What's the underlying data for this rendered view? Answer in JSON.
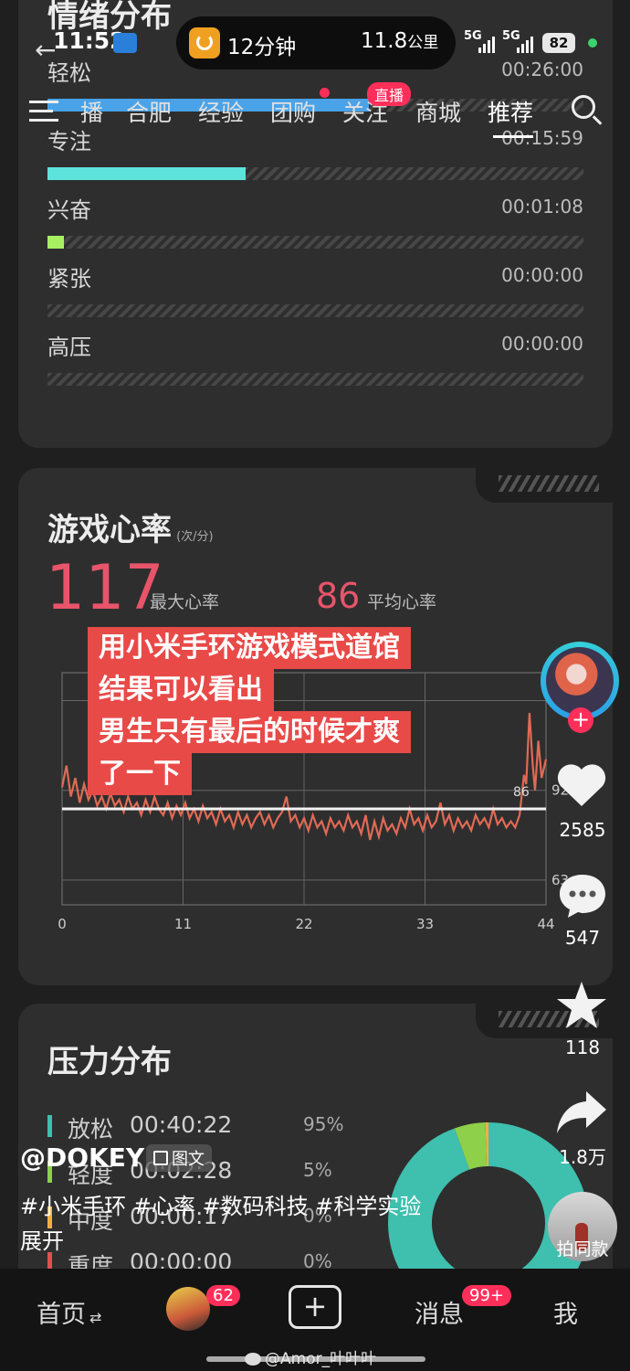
{
  "status_bar": {
    "time": "11:52",
    "ride_time": "12分钟",
    "ride_distance": "11.8",
    "ride_unit": "公里",
    "battery": "82",
    "net1": "5G",
    "net2": "5G"
  },
  "top_tabs": {
    "items": [
      "播",
      "合肥",
      "经验",
      "团购",
      "关注",
      "商城",
      "推荐"
    ],
    "live_badge": "直播"
  },
  "emotion": {
    "title": "情绪分布",
    "rows": [
      {
        "label": "轻松",
        "time": "00:26:00",
        "fill": 0.6,
        "color": "#4aa3e8"
      },
      {
        "label": "专注",
        "time": "00:15:59",
        "fill": 0.37,
        "color": "#5de3dc"
      },
      {
        "label": "兴奋",
        "time": "00:01:08",
        "fill": 0.03,
        "color": "#a8f062"
      },
      {
        "label": "紧张",
        "time": "00:00:00",
        "fill": 0,
        "color": "#f0b040"
      },
      {
        "label": "高压",
        "time": "00:00:00",
        "fill": 0,
        "color": "#e05050"
      }
    ]
  },
  "heart": {
    "title": "游戏心率",
    "unit": "(次/分)",
    "max_value": "117",
    "max_label": "最大心率",
    "avg_value": "86",
    "avg_label": "平均心率"
  },
  "chart_data": {
    "type": "line",
    "x_ticks": [
      "0",
      "11",
      "22",
      "33",
      "44"
    ],
    "y_ticks": [
      "121",
      "92",
      "63"
    ],
    "avg_marker": "86",
    "xlim": [
      0,
      44
    ],
    "ylim": [
      55,
      130
    ],
    "avg": 86,
    "series": [
      {
        "values": [
          [
            0,
            93
          ],
          [
            0.4,
            100
          ],
          [
            0.8,
            90
          ],
          [
            1.2,
            96
          ],
          [
            1.6,
            88
          ],
          [
            2,
            94
          ],
          [
            2.4,
            89
          ],
          [
            2.8,
            92
          ],
          [
            3.2,
            87
          ],
          [
            3.6,
            90
          ],
          [
            4,
            86
          ],
          [
            4.4,
            91
          ],
          [
            4.8,
            87
          ],
          [
            5.2,
            89
          ],
          [
            5.6,
            85
          ],
          [
            6,
            90
          ],
          [
            6.4,
            86
          ],
          [
            6.8,
            88
          ],
          [
            7.2,
            84
          ],
          [
            7.6,
            89
          ],
          [
            8,
            85
          ],
          [
            8.4,
            90
          ],
          [
            8.8,
            86
          ],
          [
            9.2,
            84
          ],
          [
            9.6,
            88
          ],
          [
            10,
            83
          ],
          [
            10.4,
            87
          ],
          [
            10.8,
            84
          ],
          [
            11.2,
            88
          ],
          [
            11.6,
            83
          ],
          [
            12,
            86
          ],
          [
            12.4,
            82
          ],
          [
            12.8,
            87
          ],
          [
            13.2,
            83
          ],
          [
            13.6,
            85
          ],
          [
            14,
            81
          ],
          [
            14.4,
            86
          ],
          [
            14.8,
            82
          ],
          [
            15.2,
            84
          ],
          [
            15.6,
            80
          ],
          [
            16,
            85
          ],
          [
            16.4,
            81
          ],
          [
            16.8,
            84
          ],
          [
            17.2,
            80
          ],
          [
            17.6,
            83
          ],
          [
            18,
            85
          ],
          [
            18.4,
            81
          ],
          [
            18.8,
            84
          ],
          [
            19.2,
            80
          ],
          [
            19.6,
            83
          ],
          [
            20,
            85
          ],
          [
            20.4,
            90
          ],
          [
            20.8,
            82
          ],
          [
            21.2,
            84
          ],
          [
            21.6,
            80
          ],
          [
            22,
            83
          ],
          [
            22.4,
            79
          ],
          [
            22.8,
            84
          ],
          [
            23.2,
            80
          ],
          [
            23.6,
            82
          ],
          [
            24,
            78
          ],
          [
            24.4,
            83
          ],
          [
            24.8,
            80
          ],
          [
            25.2,
            82
          ],
          [
            25.6,
            79
          ],
          [
            26,
            84
          ],
          [
            26.4,
            80
          ],
          [
            26.8,
            82
          ],
          [
            27.2,
            78
          ],
          [
            27.6,
            84
          ],
          [
            28,
            76
          ],
          [
            28.4,
            82
          ],
          [
            28.8,
            77
          ],
          [
            29.2,
            83
          ],
          [
            29.6,
            79
          ],
          [
            30,
            81
          ],
          [
            30.4,
            78
          ],
          [
            30.8,
            83
          ],
          [
            31.2,
            80
          ],
          [
            31.6,
            86
          ],
          [
            32,
            81
          ],
          [
            32.4,
            83
          ],
          [
            32.8,
            79
          ],
          [
            33.2,
            84
          ],
          [
            33.6,
            80
          ],
          [
            34,
            82
          ],
          [
            34.4,
            88
          ],
          [
            34.8,
            81
          ],
          [
            35.2,
            84
          ],
          [
            35.6,
            79
          ],
          [
            36,
            83
          ],
          [
            36.4,
            80
          ],
          [
            36.8,
            82
          ],
          [
            37.2,
            79
          ],
          [
            37.6,
            84
          ],
          [
            38,
            81
          ],
          [
            38.4,
            83
          ],
          [
            38.8,
            80
          ],
          [
            39.2,
            86
          ],
          [
            39.6,
            81
          ],
          [
            40,
            83
          ],
          [
            40.4,
            80
          ],
          [
            40.8,
            82
          ],
          [
            41.2,
            80
          ],
          [
            41.6,
            84
          ],
          [
            42,
            97
          ],
          [
            42.2,
            94
          ],
          [
            42.5,
            117
          ],
          [
            42.8,
            100
          ],
          [
            43,
            92
          ],
          [
            43.3,
            108
          ],
          [
            43.6,
            96
          ],
          [
            44,
            102
          ]
        ]
      }
    ]
  },
  "caption": {
    "lines": [
      "用小米手环游戏模式道馆",
      "结果可以看出",
      "男生只有最后的时候才爽",
      "了一下"
    ]
  },
  "pressure": {
    "title": "压力分布",
    "rows": [
      {
        "label": "放松",
        "time": "00:40:22",
        "pct": "95%",
        "color": "#3fbfae",
        "value": 95
      },
      {
        "label": "轻度",
        "time": "00:02:28",
        "pct": "5%",
        "color": "#8ed04a",
        "value": 5
      },
      {
        "label": "中度",
        "time": "00:00:17",
        "pct": "0%",
        "color": "#f0b040",
        "value": 0.5
      },
      {
        "label": "重度",
        "time": "00:00:00",
        "pct": "0%",
        "color": "#e05050",
        "value": 0
      }
    ]
  },
  "actions": {
    "likes": "2585",
    "comments": "547",
    "favorites": "118",
    "shares": "1.8万",
    "same_style": "拍同款"
  },
  "post": {
    "author": "@DOKEY",
    "type_badge": "图文",
    "hashtags": "#小米手环 #心率 #数码科技 #科学实验",
    "expand": "展开"
  },
  "bottom_nav": {
    "home": "首页",
    "friends_badge": "62",
    "messages": "消息",
    "messages_badge": "99+",
    "me": "我"
  },
  "watermark": "@Amor_叶叶叶"
}
